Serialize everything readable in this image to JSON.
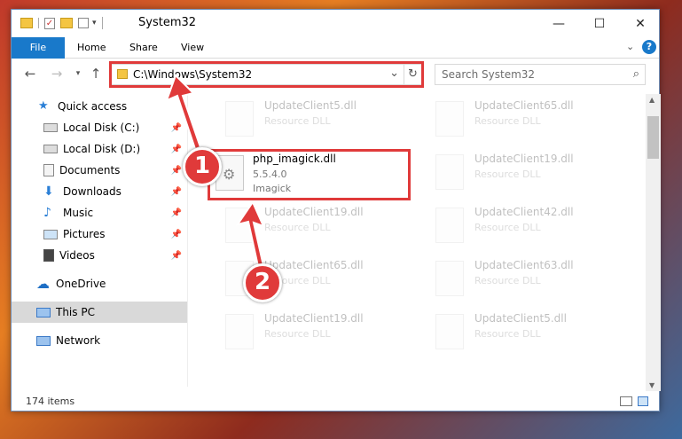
{
  "window": {
    "title": "System32"
  },
  "ribbon": {
    "tabs": [
      "File",
      "Home",
      "Share",
      "View"
    ]
  },
  "address": {
    "path": "C:\\Windows\\System32"
  },
  "search": {
    "placeholder": "Search System32"
  },
  "sidebar": {
    "items": [
      {
        "label": "Quick access",
        "icon": "star-icon",
        "pinned": false
      },
      {
        "label": "Local Disk (C:)",
        "icon": "drive-icon",
        "pinned": true
      },
      {
        "label": "Local Disk (D:)",
        "icon": "drive-icon",
        "pinned": true
      },
      {
        "label": "Documents",
        "icon": "documents-icon",
        "pinned": true
      },
      {
        "label": "Downloads",
        "icon": "downloads-icon",
        "pinned": true
      },
      {
        "label": "Music",
        "icon": "music-icon",
        "pinned": true
      },
      {
        "label": "Pictures",
        "icon": "pictures-icon",
        "pinned": true
      },
      {
        "label": "Videos",
        "icon": "videos-icon",
        "pinned": true
      },
      {
        "label": "OneDrive",
        "icon": "cloud-icon",
        "pinned": false
      },
      {
        "label": "This PC",
        "icon": "computer-icon",
        "pinned": false
      },
      {
        "label": "Network",
        "icon": "network-icon",
        "pinned": false
      }
    ]
  },
  "files": [
    {
      "name": "UpdateClient5.dll",
      "type": "Resource DLL"
    },
    {
      "name": "UpdateClient65.dll",
      "type": "Resource DLL"
    },
    {
      "name": "UpdateClient19.dll",
      "type": "Resource DLL"
    },
    {
      "name": "UpdateClient19.dll",
      "type": "Resource DLL"
    },
    {
      "name": "UpdateClient42.dll",
      "type": "Resource DLL"
    },
    {
      "name": "UpdateClient65.dll",
      "type": "Resource DLL"
    },
    {
      "name": "UpdateClient63.dll",
      "type": "Resource DLL"
    },
    {
      "name": "UpdateClient19.dll",
      "type": "Resource DLL"
    },
    {
      "name": "UpdateClient5.dll",
      "type": "Resource DLL"
    }
  ],
  "highlighted_file": {
    "name": "php_imagick.dll",
    "version": "5.5.4.0",
    "company": "Imagick"
  },
  "status": {
    "count": "174 items"
  },
  "annotations": {
    "step1": "1",
    "step2": "2"
  },
  "colors": {
    "accent": "#1979ca",
    "highlight": "#e03a3a"
  }
}
